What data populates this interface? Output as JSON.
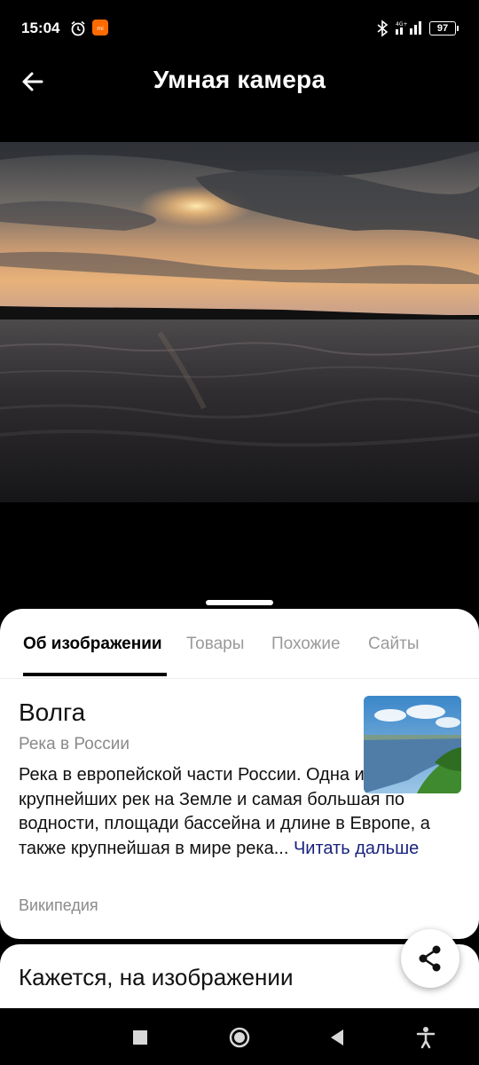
{
  "status_bar": {
    "time": "15:04",
    "battery": "97",
    "icons": [
      "alarm-icon",
      "app-notification-icon",
      "bluetooth-icon",
      "signal-4g-icon",
      "battery-icon"
    ]
  },
  "header": {
    "title": "Умная камера",
    "back_icon": "arrow-left-icon"
  },
  "tabs": [
    {
      "label": "Об изображении",
      "active": true
    },
    {
      "label": "Товары",
      "active": false
    },
    {
      "label": "Похожие",
      "active": false
    },
    {
      "label": "Сайты",
      "active": false
    }
  ],
  "entity": {
    "name": "Волга",
    "subtitle": "Река в России",
    "description": "Река в европейской части России. Одна из крупнейших рек на Земле и самая большая по водности, площади бассейна и длине в Европе, а также крупнейшая в мире река...",
    "read_more": "Читать дальше",
    "source": "Википедия"
  },
  "next_section": {
    "title": "Кажется, на изображении"
  },
  "colors": {
    "accent_link": "#1a237e",
    "muted_text": "#8a8a8a"
  }
}
